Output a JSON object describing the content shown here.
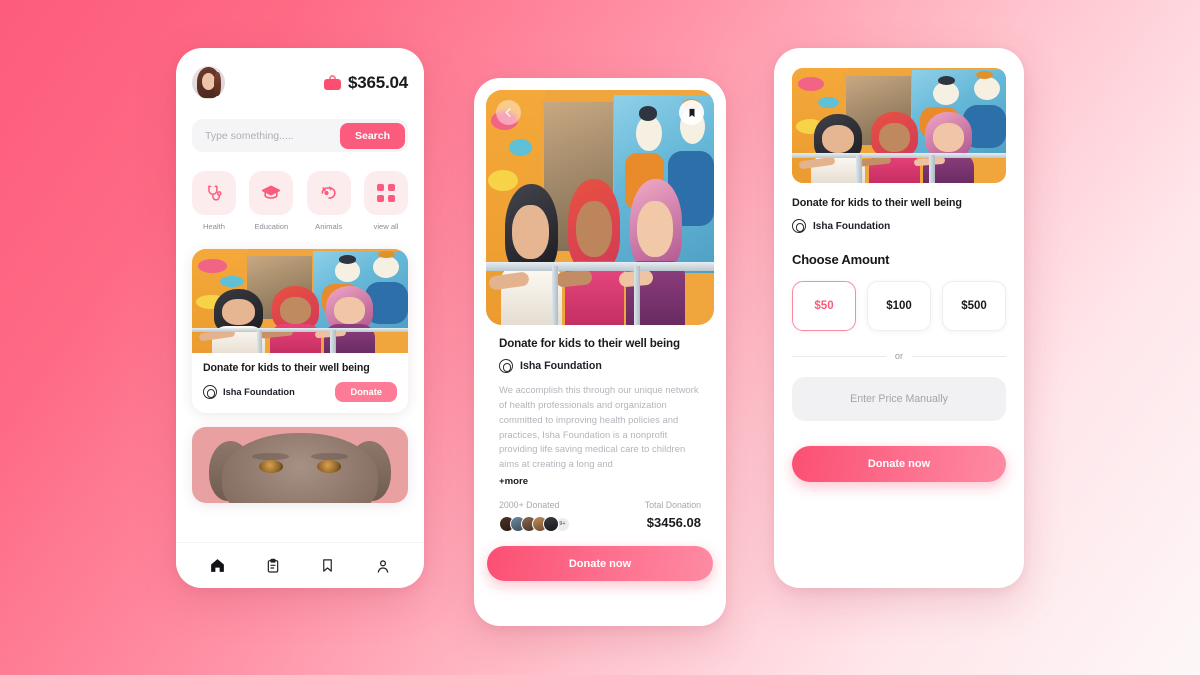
{
  "app": {
    "accent": "#fb5b7c",
    "accent_dark": "#fb4f72",
    "background_from": "#fd5c7c",
    "background_to": "#fdf7f8"
  },
  "phone1": {
    "avatar": "user-avatar",
    "wallet_icon": "wallet-icon",
    "balance": "$365.04",
    "search": {
      "placeholder": "Type something.....",
      "value": "",
      "button_label": "Search"
    },
    "categories": [
      {
        "label": "Health",
        "icon": "stethoscope-icon"
      },
      {
        "label": "Education",
        "icon": "graduation-cap-icon"
      },
      {
        "label": "Animals",
        "icon": "pet-icon"
      },
      {
        "label": "view all",
        "icon": "grid-icon"
      }
    ],
    "card": {
      "image": "three-girls-at-railing-photo",
      "title": "Donate for kids to their well being",
      "org": "Isha Foundation",
      "org_icon": "org-badge-icon",
      "donate_label": "Donate"
    },
    "card2": {
      "image": "dog-photo"
    },
    "nav": [
      {
        "name": "home-icon",
        "active": true
      },
      {
        "name": "clipboard-icon",
        "active": false
      },
      {
        "name": "bookmark-icon",
        "active": false
      },
      {
        "name": "person-icon",
        "active": false
      }
    ]
  },
  "phone2": {
    "back_icon": "chevron-left-icon",
    "bookmark_icon": "bookmark-icon",
    "image": "three-girls-at-railing-photo",
    "title": "Donate for kids to their well being",
    "org": "Isha Foundation",
    "org_icon": "org-badge-icon",
    "description": "We accomplish this through our unique network of health professionals and organization committed to improving health policies and practices, Isha Foundation is a nonprofit providing life saving medical care to children aims at creating a long and",
    "more_label": "+more",
    "donated_label": "2000+ Donated",
    "donor_overflow": "9+",
    "total_label": "Total Donation",
    "total_amount": "$3456.08",
    "donate_label": "Donate now"
  },
  "phone3": {
    "image": "three-girls-at-railing-photo",
    "title": "Donate for kids to their well being",
    "org": "Isha Foundation",
    "org_icon": "org-badge-icon",
    "choose_amount_label": "Choose Amount",
    "amounts": [
      {
        "label": "$50",
        "selected": true
      },
      {
        "label": "$100",
        "selected": false
      },
      {
        "label": "$500",
        "selected": false
      }
    ],
    "or_label": "or",
    "manual": {
      "placeholder": "Enter Price Manually",
      "value": ""
    },
    "donate_label": "Donate now"
  }
}
